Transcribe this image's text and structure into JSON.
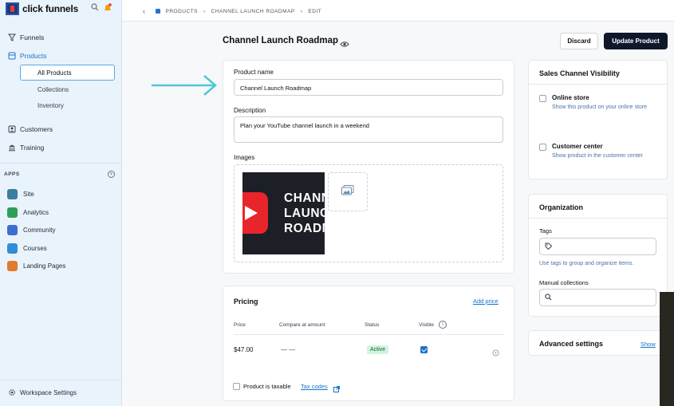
{
  "sidebar": {
    "brand": "click funnels",
    "nav": [
      {
        "label": "Funnels",
        "icon": "filter-icon"
      },
      {
        "label": "Products",
        "icon": "products-icon"
      },
      {
        "label": "Customers",
        "icon": "customers-icon"
      },
      {
        "label": "Training",
        "icon": "training-icon"
      }
    ],
    "sub_items": [
      "All Products",
      "Collections",
      "Inventory"
    ],
    "apps_label": "APPS",
    "apps": [
      {
        "label": "Site",
        "color": "#3b7ea1"
      },
      {
        "label": "Analytics",
        "color": "#2e9e5b"
      },
      {
        "label": "Community",
        "color": "#3b6fd1"
      },
      {
        "label": "Courses",
        "color": "#2f8fd6"
      },
      {
        "label": "Landing Pages",
        "color": "#e07b2e"
      }
    ],
    "workspace_settings": "Workspace Settings"
  },
  "breadcrumb": {
    "back": "‹",
    "products": "PRODUCTS",
    "sep": "›",
    "product": "CHANNEL LAUNCH ROADMAP",
    "edit": "EDIT"
  },
  "header": {
    "title": "Channel Launch Roadmap",
    "discard": "Discard",
    "update": "Update Product"
  },
  "details": {
    "name_label": "Product name",
    "name_value": "Channel Launch Roadmap",
    "description_label": "Description",
    "description_value": "Plan your YouTube channel launch in a weekend",
    "images_label": "Images",
    "thumbnail_text": "CHANNEL\nLAUNCH\nROADMAP"
  },
  "pricing": {
    "title": "Pricing",
    "add_price": "Add price",
    "columns": [
      "Price",
      "Compare at amount",
      "Status",
      "Visible"
    ],
    "row": {
      "price": "$47.00",
      "compare": "— —",
      "status": "Active",
      "visible": true
    },
    "taxable_label": "Product is taxable",
    "tax_codes": "Tax codes"
  },
  "visibility": {
    "title": "Sales Channel Visibility",
    "options": [
      {
        "label": "Online store",
        "desc": "Show this product on your online store"
      },
      {
        "label": "Customer center",
        "desc": "Show product in the customer center"
      }
    ]
  },
  "organization": {
    "title": "Organization",
    "tags_label": "Tags",
    "tags_help": "Use tags to group and organize items.",
    "collections_label": "Manual collections"
  },
  "advanced": {
    "title": "Advanced settings",
    "show": "Show"
  },
  "colors": {
    "accent": "#1a73c9",
    "primary_button": "#0f172a",
    "annotation_arrow": "#4fc7d6"
  }
}
